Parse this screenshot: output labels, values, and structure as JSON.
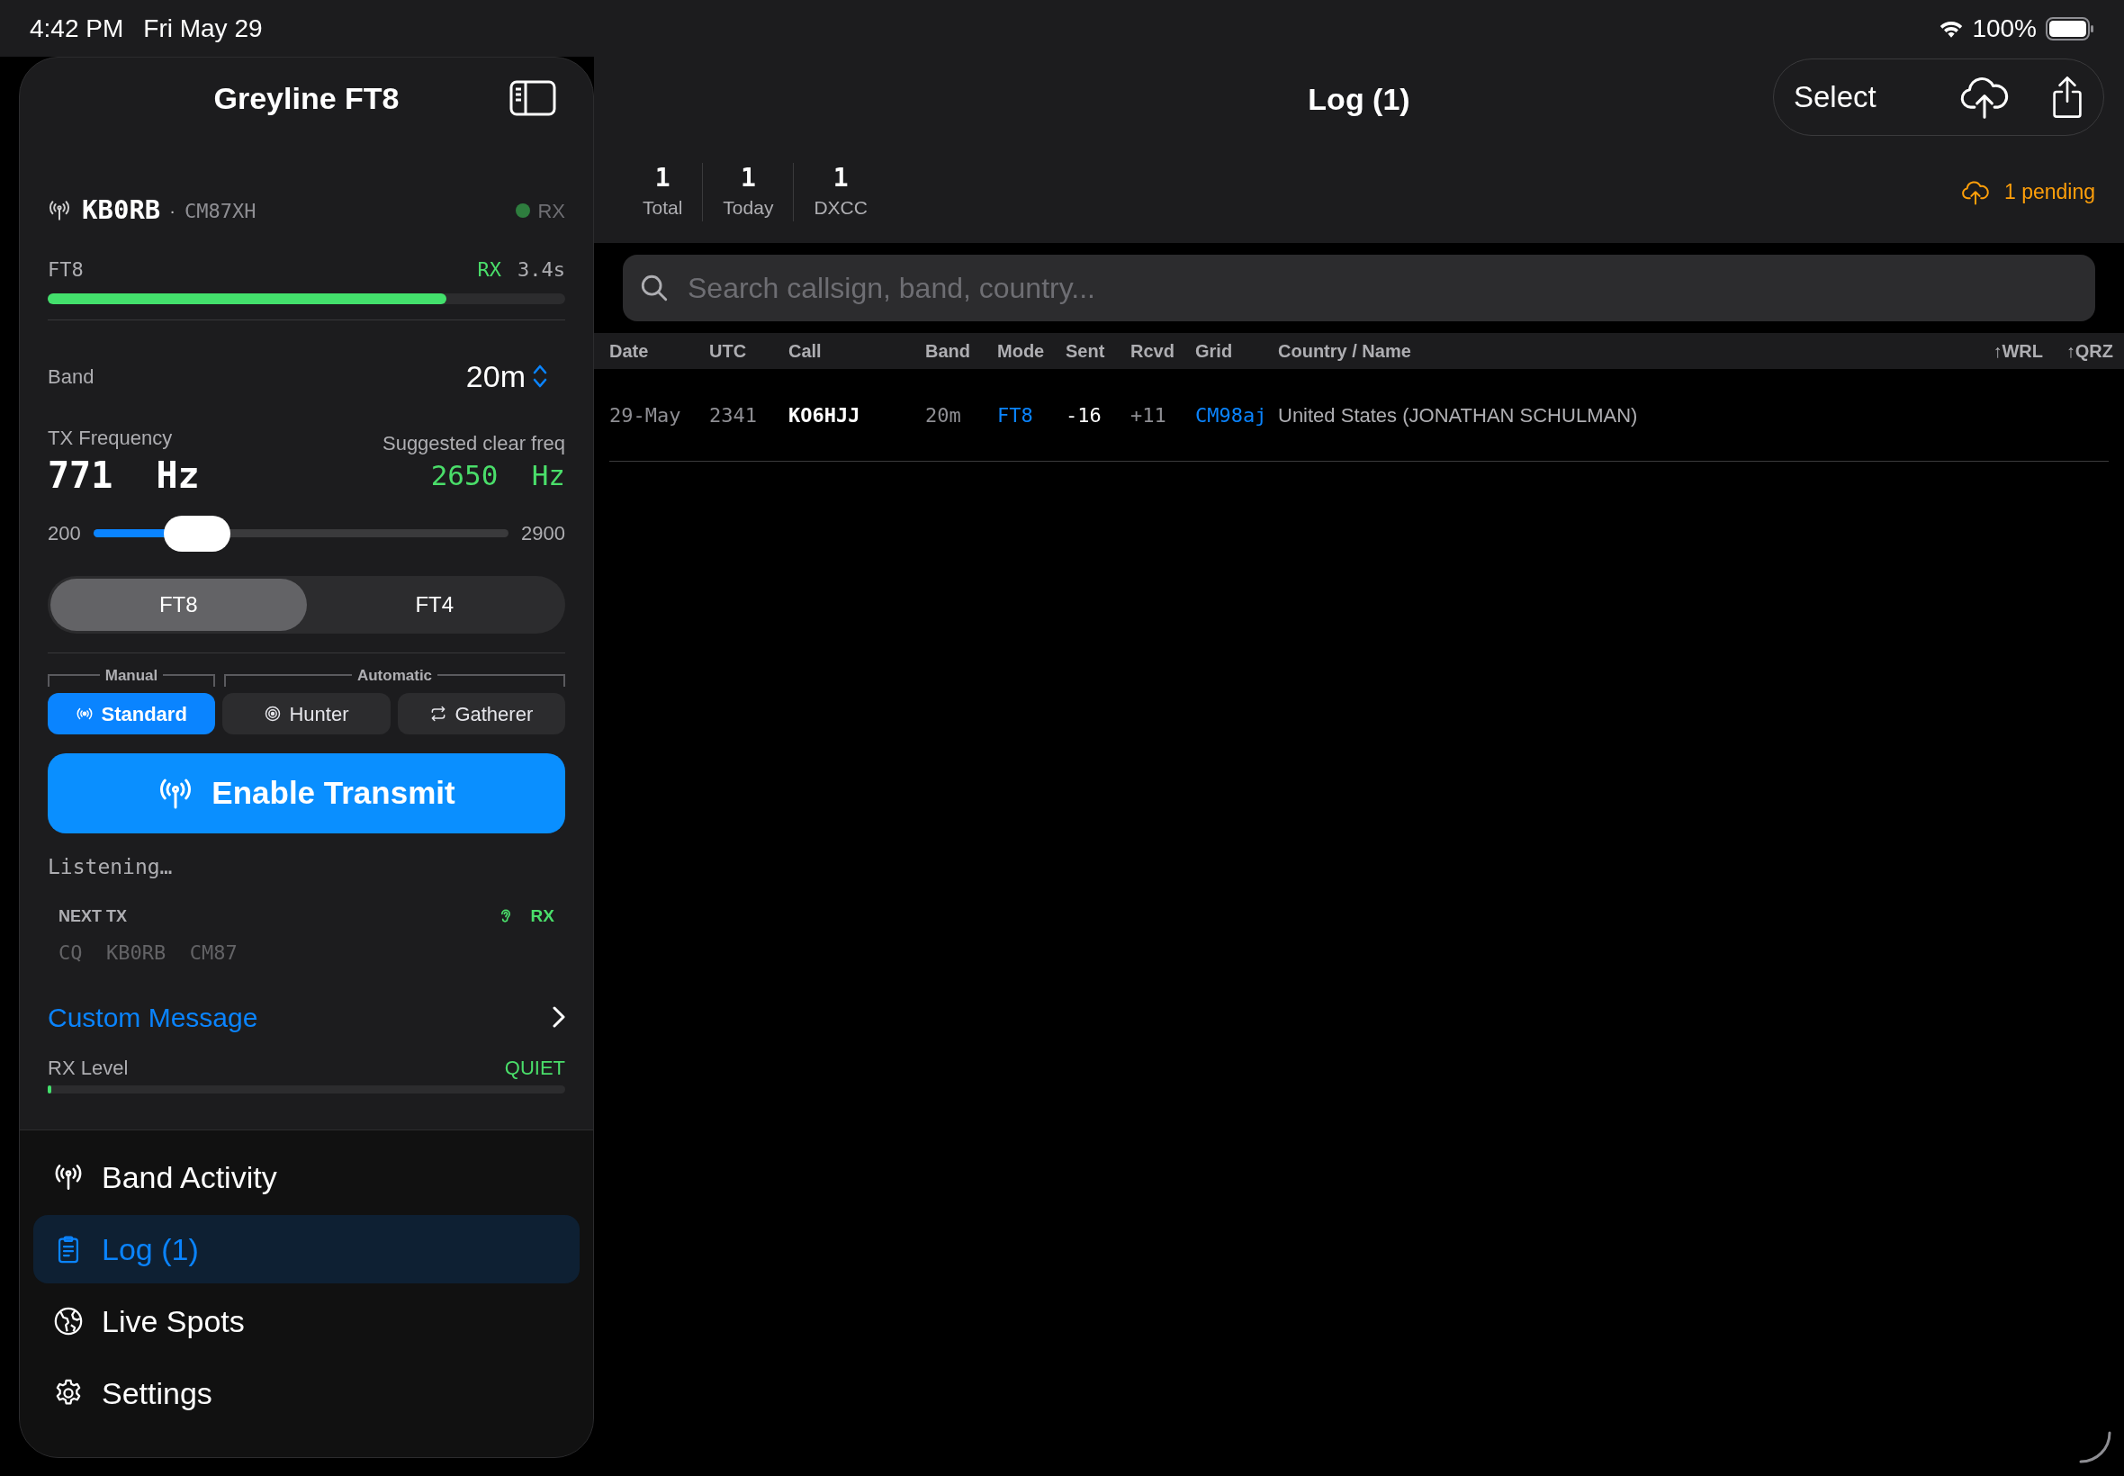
{
  "status_bar": {
    "time": "4:42 PM",
    "date": "Fri May 29",
    "battery": "100%"
  },
  "sidebar": {
    "title": "Greyline FT8",
    "station": {
      "callsign": "KB0RB",
      "separator": "·",
      "grid": "CM87XH",
      "status": "RX",
      "color": "#2e7d3e"
    },
    "cycle": {
      "mode": "FT8",
      "state": "RX",
      "time": "3.4s",
      "level": 0.77
    },
    "band": {
      "label": "Band",
      "value": "20m"
    },
    "tx": {
      "label": "TX Frequency",
      "value": "771  Hz",
      "suggested_label": "Suggested clear freq",
      "suggested_value": "2650  Hz"
    },
    "slider": {
      "min": "200",
      "max": "2900",
      "level": 0.25
    },
    "modes": [
      {
        "label": "FT8",
        "selected": true
      },
      {
        "label": "FT4",
        "selected": false
      }
    ],
    "strategy_groups": [
      {
        "label": "Manual"
      },
      {
        "label": "Automatic"
      }
    ],
    "strategies": [
      {
        "label": "Standard",
        "kind": "broadcast",
        "selected": true
      },
      {
        "label": "Hunter",
        "kind": "target",
        "selected": false
      },
      {
        "label": "Gatherer",
        "kind": "cycle",
        "selected": false
      }
    ],
    "transmit_button": "Enable Transmit",
    "listening": "Listening…",
    "next_tx": {
      "label": "NEXT TX",
      "state": "RX",
      "message": "CQ  KB0RB  CM87"
    },
    "custom_message": "Custom Message",
    "rx_level": {
      "label": "RX Level",
      "reading": "QUIET",
      "level": 0.006
    },
    "nav": [
      {
        "label": "Band Activity",
        "kind": "antenna",
        "selected": false
      },
      {
        "label": "Log (1)",
        "kind": "clipboard",
        "selected": true
      },
      {
        "label": "Live Spots",
        "kind": "globe",
        "selected": false
      },
      {
        "label": "Settings",
        "kind": "gear",
        "selected": false
      }
    ]
  },
  "main": {
    "title": "Log (1)",
    "select": "Select",
    "stats": [
      {
        "value": "1",
        "label": "Total"
      },
      {
        "value": "1",
        "label": "Today"
      },
      {
        "value": "1",
        "label": "DXCC"
      }
    ],
    "pending": "1 pending",
    "search": {
      "placeholder": "Search callsign, band, country..."
    },
    "table": {
      "columns": [
        "Date",
        "UTC",
        "Call",
        "Band",
        "Mode",
        "Sent",
        "Rcvd",
        "Grid",
        "Country / Name",
        "↑WRL",
        "↑QRZ"
      ],
      "rows": [
        {
          "cells": [
            "29-May",
            "2341",
            "KO6HJJ",
            "20m",
            "FT8",
            "-16",
            "+11",
            "CM98aj",
            "United States (JONATHAN SCHULMAN)"
          ]
        }
      ]
    }
  }
}
